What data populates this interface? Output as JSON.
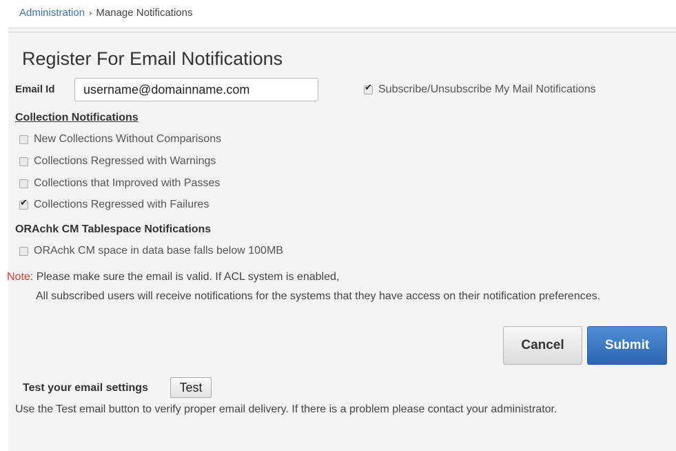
{
  "breadcrumb": {
    "root": "Administration",
    "separator": "›",
    "current": "Manage Notifications"
  },
  "page_title": "Register For Email Notifications",
  "email": {
    "label": "Email Id",
    "value": "username@domainname.com"
  },
  "subscribe": {
    "label": "Subscribe/Unsubscribe My Mail Notifications",
    "checked": true
  },
  "collection_notifications": {
    "heading": "Collection Notifications",
    "options": [
      {
        "label": "New Collections Without Comparisons",
        "checked": false
      },
      {
        "label": "Collections Regressed with Warnings",
        "checked": false
      },
      {
        "label": "Collections that Improved with Passes",
        "checked": false
      },
      {
        "label": "Collections Regressed with Failures",
        "checked": true
      }
    ]
  },
  "tablespace_notifications": {
    "heading": "ORAchk CM Tablespace Notifications",
    "options": [
      {
        "label": "ORAchk CM space in data base falls below 100MB",
        "checked": false
      }
    ]
  },
  "note": {
    "label": "Note:",
    "line1": " Please make sure the email is valid. If ACL system is enabled,",
    "line2": "All subscribed users will receive notifications for the systems that they have access on their notification preferences."
  },
  "buttons": {
    "cancel": "Cancel",
    "submit": "Submit",
    "test": "Test"
  },
  "test_email": {
    "label": "Test your email settings",
    "help": "Use the Test email button to verify proper email delivery. If there is a problem please contact your administrator."
  },
  "colors": {
    "accent": "#2c66b0",
    "link": "#3a6fb0",
    "note": "#e23d2f"
  }
}
